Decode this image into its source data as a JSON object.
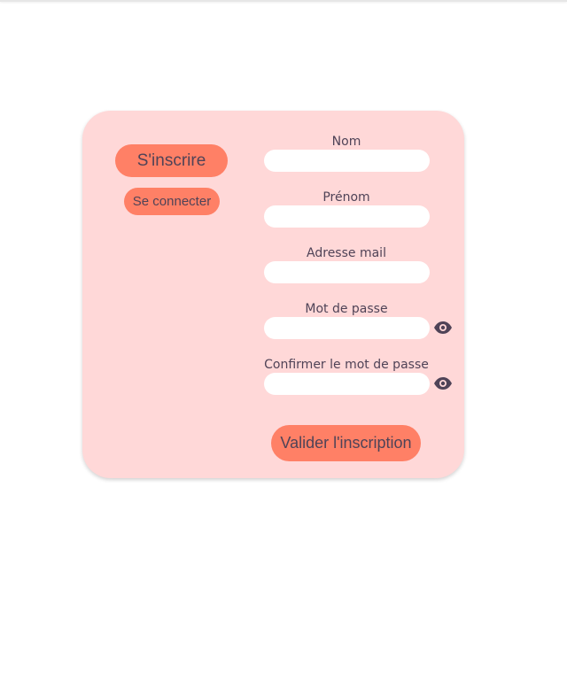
{
  "tabs": {
    "signup_label": "S'inscrire",
    "login_label": "Se connecter"
  },
  "form": {
    "fields": [
      {
        "label": "Nom",
        "value": "",
        "placeholder": ""
      },
      {
        "label": "Prénom",
        "value": "",
        "placeholder": ""
      },
      {
        "label": "Adresse mail",
        "value": "",
        "placeholder": ""
      },
      {
        "label": "Mot de passe",
        "value": "",
        "placeholder": ""
      },
      {
        "label": "Confirmer le mot de passe",
        "value": "",
        "placeholder": ""
      }
    ],
    "submit_label": "Valider l'inscription"
  },
  "icons": {
    "password_toggle": "eye-icon",
    "confirm_password_toggle": "eye-icon"
  },
  "colors": {
    "card_background": "#ffd8d8",
    "button": "#ff8066",
    "text": "#4f4357",
    "input_background": "#ffffff"
  }
}
